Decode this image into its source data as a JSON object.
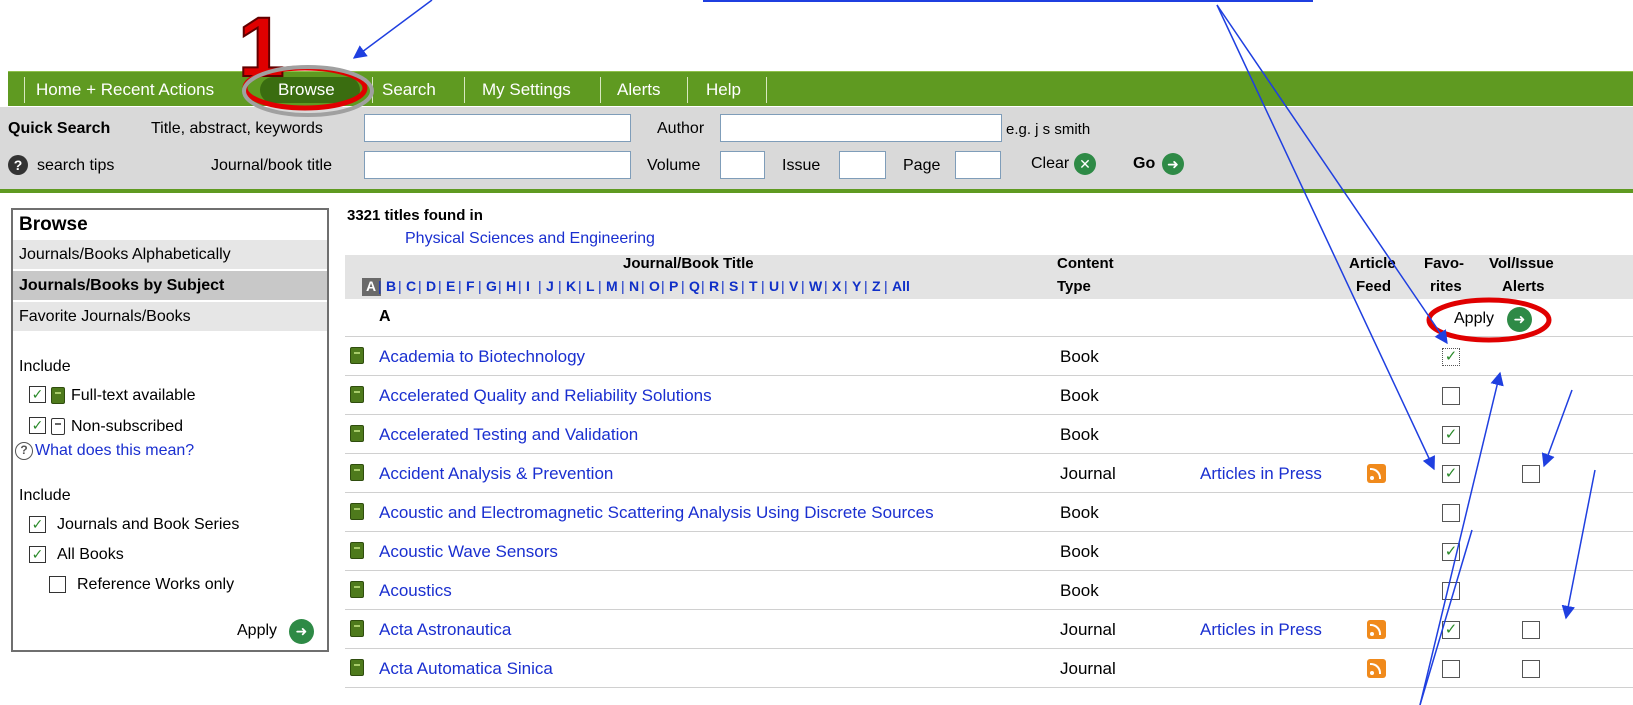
{
  "annotation": {
    "step_number": "1"
  },
  "nav": {
    "items": [
      "Home + Recent Actions",
      "Browse",
      "Search",
      "My Settings",
      "Alerts",
      "Help"
    ]
  },
  "quick_search": {
    "title": "Quick Search",
    "tips_label": "search tips",
    "fields": {
      "title_abstract_label": "Title, abstract, keywords",
      "author_label": "Author",
      "author_hint": "e.g. j s smith",
      "journal_title_label": "Journal/book title",
      "volume_label": "Volume",
      "issue_label": "Issue",
      "page_label": "Page"
    },
    "clear_label": "Clear",
    "go_label": "Go"
  },
  "sidebar": {
    "title": "Browse",
    "items": [
      "Journals/Books Alphabetically",
      "Journals/Books by Subject",
      "Favorite Journals/Books"
    ],
    "include_label_1": "Include",
    "fulltext_label": "Full-text available",
    "nonsub_label": "Non-subscribed",
    "what_label": "What does this mean?",
    "include_label_2": "Include",
    "journals_series_label": "Journals and Book Series",
    "all_books_label": "All Books",
    "reference_label": "Reference Works only",
    "apply_label": "Apply"
  },
  "results": {
    "count_text": "3321 titles found in",
    "subject": "Physical Sciences and Engineering",
    "col_title": "Journal/Book Title",
    "col_content_1": "Content",
    "col_content_2": "Type",
    "col_feed_1": "Article",
    "col_feed_2": "Feed",
    "col_fav_1": "Favo-",
    "col_fav_2": "rites",
    "col_alerts_1": "Vol/Issue",
    "col_alerts_2": "Alerts",
    "letters": [
      "A",
      "B",
      "C",
      "D",
      "E",
      "F",
      "G",
      "H",
      "I",
      "J",
      "K",
      "L",
      "M",
      "N",
      "O",
      "P",
      "Q",
      "R",
      "S",
      "T",
      "U",
      "V",
      "W",
      "X",
      "Y",
      "Z",
      "All"
    ],
    "section_letter": "A",
    "apply_label": "Apply",
    "rows": [
      {
        "title": "Academia to Biotechnology",
        "type": "Book",
        "aip": "",
        "fav": "✓"
      },
      {
        "title": "Accelerated Quality and Reliability Solutions",
        "type": "Book",
        "aip": "",
        "fav": ""
      },
      {
        "title": "Accelerated Testing and Validation",
        "type": "Book",
        "aip": "",
        "fav": "✓"
      },
      {
        "title": "Accident Analysis & Prevention",
        "type": "Journal",
        "aip": "Articles in Press",
        "fav": "✓"
      },
      {
        "title": "Acoustic and Electromagnetic Scattering Analysis Using Discrete Sources",
        "type": "Book",
        "aip": "",
        "fav": ""
      },
      {
        "title": "Acoustic Wave Sensors",
        "type": "Book",
        "aip": "",
        "fav": "✓"
      },
      {
        "title": "Acoustics",
        "type": "Book",
        "aip": "",
        "fav": ""
      },
      {
        "title": "Acta Astronautica",
        "type": "Journal",
        "aip": "Articles in Press",
        "fav": "✓"
      },
      {
        "title": "Acta Automatica Sinica",
        "type": "Journal",
        "aip": "",
        "fav": ""
      }
    ]
  },
  "colors": {
    "nav_green": "#5f9a21",
    "link_blue": "#1a2fd0",
    "highlight_red": "#e00000",
    "arrow_blue": "#1f3fe0"
  }
}
